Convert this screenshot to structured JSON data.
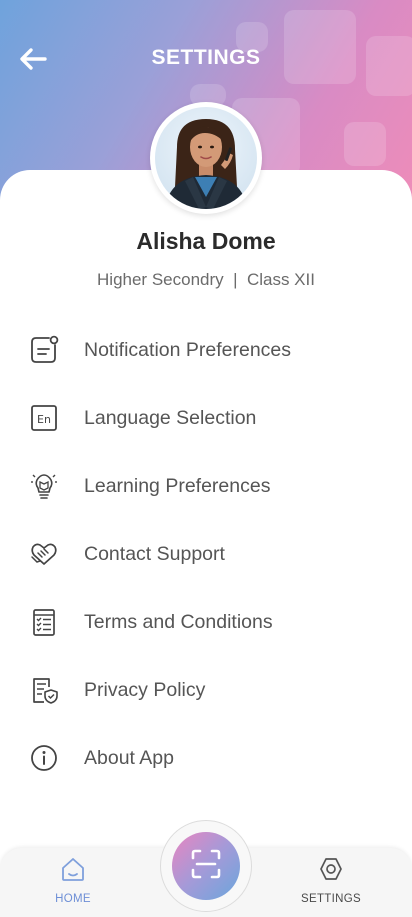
{
  "header": {
    "title": "SETTINGS",
    "back_icon": "arrow-left-icon"
  },
  "profile": {
    "name": "Alisha Dome",
    "subtitle": "Higher Secondry  |  Class XII",
    "avatar_icon": "avatar"
  },
  "menu": {
    "items": [
      {
        "label": "Notification Preferences",
        "icon": "notification-icon"
      },
      {
        "label": "Language Selection",
        "icon": "language-icon"
      },
      {
        "label": "Learning Preferences",
        "icon": "learning-icon"
      },
      {
        "label": "Contact Support",
        "icon": "handshake-icon"
      },
      {
        "label": "Terms and Conditions",
        "icon": "document-list-icon"
      },
      {
        "label": "Privacy Policy",
        "icon": "privacy-shield-icon"
      },
      {
        "label": "About App",
        "icon": "info-icon"
      }
    ]
  },
  "bottom_nav": {
    "home_label": "HOME",
    "settings_label": "SETTINGS",
    "scan_icon": "scan-icon"
  },
  "colors": {
    "gradient_start": "#6fa3dc",
    "gradient_end": "#f08db8",
    "home_active": "#6e8fd6",
    "text_primary": "#2b2b2b",
    "text_secondary": "#555555"
  }
}
